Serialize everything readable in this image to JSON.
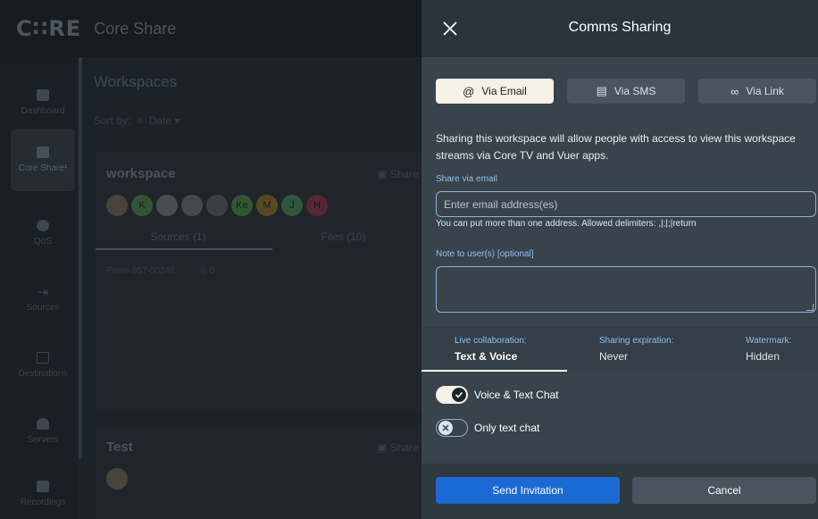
{
  "app": {
    "logo": "C∷RE",
    "title": "Core Share"
  },
  "sidebar": {
    "items": [
      {
        "label": "Dashboard",
        "icon": "dashboard-icon"
      },
      {
        "label": "Core Share¹",
        "icon": "core-share-icon"
      },
      {
        "label": "QoS",
        "icon": "qos-icon"
      },
      {
        "label": "Sources",
        "icon": "sources-icon"
      },
      {
        "label": "Destinations",
        "icon": "destinations-icon"
      },
      {
        "label": "Servers",
        "icon": "servers-icon"
      },
      {
        "label": "Recordings",
        "icon": "recordings-icon"
      }
    ]
  },
  "workspaces": {
    "title": "Workspaces",
    "sort_label": "Sort by:",
    "sort_value": "Date",
    "cards": [
      {
        "title": "workspace",
        "share_label": "Share",
        "avatars": [
          "",
          "K",
          "",
          "",
          "",
          "Ke",
          "M",
          "J",
          "H"
        ],
        "tabs": [
          "Sources (1)",
          "Files (10)"
        ],
        "row": "Prism-857-00246",
        "row_count": "0"
      },
      {
        "title": "Test",
        "share_label": "Share"
      }
    ]
  },
  "panel": {
    "title": "Comms Sharing",
    "channels": {
      "email": "Via Email",
      "sms": "Via SMS",
      "link": "Via Link"
    },
    "description": "Sharing this workspace will allow people with access to view this workspace streams via Core TV and Vuer apps.",
    "email_section_label": "Share via email",
    "email_placeholder": "Enter email address(es)",
    "email_hint": "You can put more than one address. Allowed delimiters: ,|;|;|return",
    "note_label": "Note to user(s) [optional]",
    "tabs": {
      "live": {
        "label": "Live collaboration:",
        "value": "Text & Voice"
      },
      "expiration": {
        "label": "Sharing expiration:",
        "value": "Never"
      },
      "watermark": {
        "label": "Watermark:",
        "value": "Hidden"
      }
    },
    "options": {
      "voice_text": "Voice & Text Chat",
      "text_only": "Only text chat"
    },
    "send_label": "Send Invitation",
    "cancel_label": "Cancel"
  },
  "colors": {
    "accent_blue": "#1b6ad3",
    "label_blue": "#8fc1f0",
    "panel_bg": "#38434b"
  }
}
